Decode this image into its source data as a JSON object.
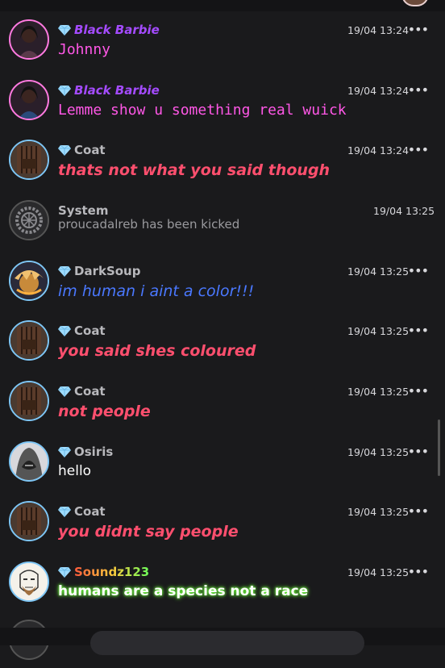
{
  "messages": [
    {
      "user": "Black Barbie",
      "time": "19/04 13:24",
      "text": "Johnny",
      "style": "barbie"
    },
    {
      "user": "Black Barbie",
      "time": "19/04 13:24",
      "text": "Lemme show u something real wuick",
      "style": "barbie"
    },
    {
      "user": "Coat",
      "time": "19/04 13:24",
      "text": "thats not what you said though",
      "style": "coat"
    },
    {
      "user": "System",
      "time": "19/04 13:25",
      "text_user": "proucadalreb",
      "text_action": " has been kicked",
      "style": "system"
    },
    {
      "user": "DarkSoup",
      "time": "19/04 13:25",
      "text": "im human i aint a color!!!",
      "style": "dark"
    },
    {
      "user": "Coat",
      "time": "19/04 13:25",
      "text": "you said shes coloured",
      "style": "coat"
    },
    {
      "user": "Coat",
      "time": "19/04 13:25",
      "text": "not people",
      "style": "coat"
    },
    {
      "user": "Osiris",
      "time": "19/04 13:25",
      "text": "hello",
      "style": "white"
    },
    {
      "user": "Coat",
      "time": "19/04 13:25",
      "text": "you didnt say people",
      "style": "coat"
    },
    {
      "user": "Soundz123",
      "time": "19/04 13:25",
      "text": "humans are a species not a race",
      "style": "soundz"
    }
  ],
  "more_icon": "•••",
  "colors": {
    "background": "#1a1a1c",
    "barbie": "#ff57e6",
    "coat": "#ff4f6e",
    "dark": "#4a78ff"
  }
}
